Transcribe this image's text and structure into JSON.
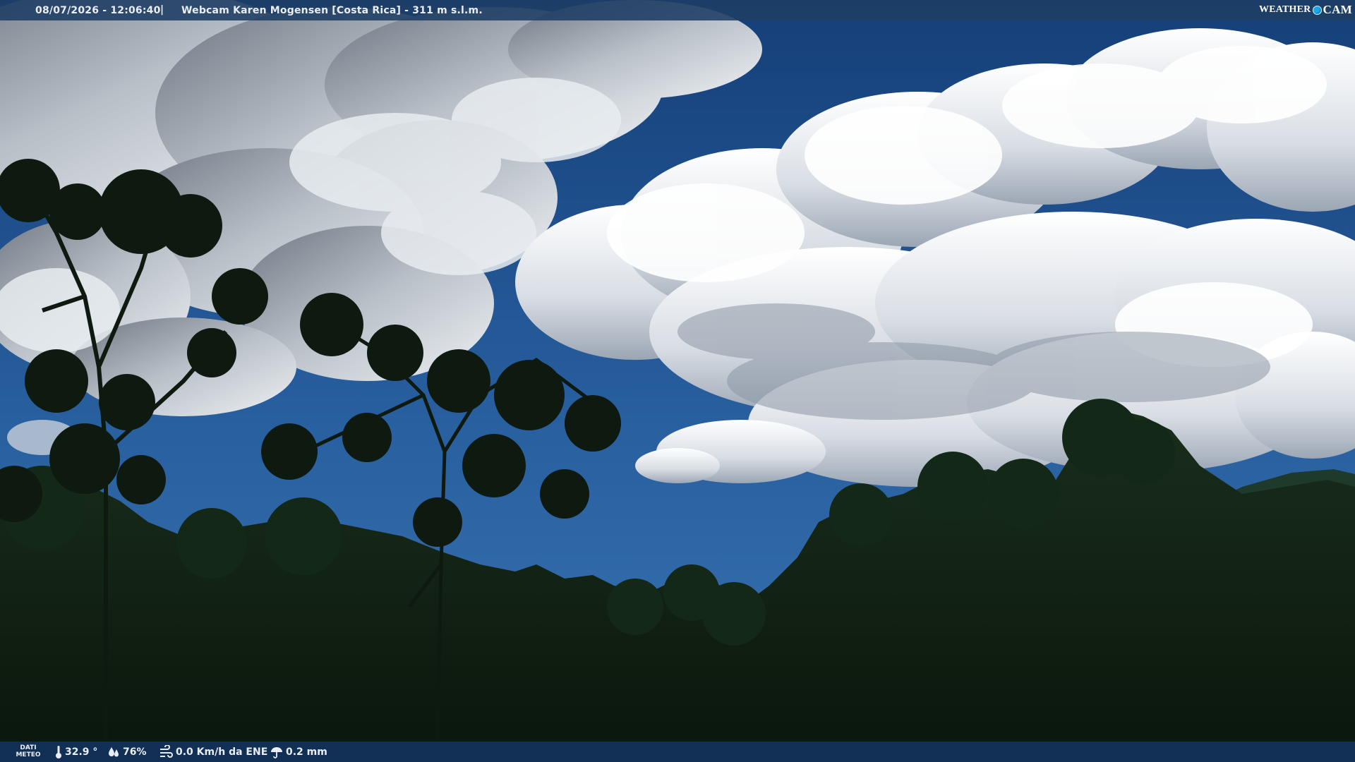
{
  "header": {
    "datetime": "08/07/2026 - 12:06:40",
    "separator": "|",
    "title": "Webcam Karen Mogensen [Costa Rica]  - 311 m s.l.m."
  },
  "brand": {
    "weather": "WEATHER",
    "cam": "CAM"
  },
  "footer": {
    "section_line1": "DATI",
    "section_line2": "METEO",
    "temperature": "32.9 °",
    "humidity": "76%",
    "wind": "0.0 Km/h da ENE",
    "rain": "0.2 mm"
  },
  "colors": {
    "sky_top": "#1c4d8a",
    "sky_bottom": "#2f6cae",
    "forest": "#0f1f12",
    "bar": "#1e3e64",
    "brand_dot": "#1aa7e8"
  },
  "icons": {
    "temperature": "thermometer-icon",
    "humidity": "humidity-drops-icon",
    "wind": "wind-icon",
    "rain": "rain-umbrella-icon"
  }
}
